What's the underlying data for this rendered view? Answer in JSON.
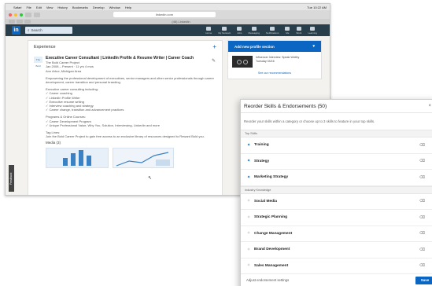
{
  "browser": {
    "menu_items": [
      "Safari",
      "File",
      "Edit",
      "View",
      "History",
      "Bookmarks",
      "Develop",
      "Window",
      "Help"
    ],
    "clock": "Tue 10:22 AM",
    "url": "linkedin.com",
    "tab_title": "(46) LinkedIn"
  },
  "linkedin": {
    "logo": "in",
    "search_placeholder": "Search",
    "nav": [
      "Home",
      "My Network",
      "Jobs",
      "Messaging",
      "Notifications",
      "Me",
      "Work",
      "Learning"
    ],
    "experience": {
      "heading": "Experience",
      "company_logo": "The Bold",
      "title": "Executive Career Consultant | LinkedIn Profile & Resume Writer | Career Coach",
      "company": "The Bold Career Project",
      "dates": "Jan 2008 – Present · 11 yrs 4 mos",
      "location": "Ann Arbor, Michigan Area",
      "summary": "Empowering the professional development of executives, senior managers and other senior professionals through career development, career transition and personal branding.",
      "services_label": "Executive career consulting including:",
      "services": [
        "✓ Career coaching",
        "✓ LinkedIn Profile Writer",
        "✓ Executive resume writing",
        "✓ Interview coaching and strategy",
        "✓ Career change, transition and advancement practices"
      ],
      "programs_label": "Programs & Online Courses:",
      "programs": [
        "✓ Career Development Program",
        "✓ Unique Professional Value, Why You, Solution, Interviewing, LinkedIn and more"
      ],
      "tag_label": "Tag Lines:",
      "tagline": "Join the Bold Career Project to gain free access to an exclusive library of resources designed to Reward Bold you.",
      "media_label": "Media (3)"
    },
    "sidebar": {
      "add_section_label": "Add new profile section",
      "item_title": "Influencer Interview: Speak Wolfey",
      "item_meta": "Tuesday 04/16",
      "recommendations_link": "See our recommendations"
    },
    "feedback_label": "Feedback"
  },
  "modal": {
    "title": "Reorder Skills & Endorsements (50)",
    "description": "Reorder your skills within a category or choose up to 3 skills to feature in your top skills.",
    "top_section_label": "Top Skills",
    "top_skills": [
      {
        "name": "Training",
        "pinned": true
      },
      {
        "name": "Strategy",
        "pinned": true
      },
      {
        "name": "Marketing Strategy",
        "pinned": true
      }
    ],
    "industry_section_label": "Industry Knowledge",
    "industry_skills": [
      {
        "name": "Social Media",
        "pinned": false
      },
      {
        "name": "Strategic Planning",
        "pinned": false
      },
      {
        "name": "Change Management",
        "pinned": false
      },
      {
        "name": "Brand Development",
        "pinned": false
      },
      {
        "name": "Sales Management",
        "pinned": false
      }
    ],
    "footer_link": "Adjust endorsement settings",
    "save_label": "Save",
    "close_glyph": "×",
    "icons": {
      "pin": "pin-icon",
      "trash": "trash-icon",
      "drag": "drag-handle-icon"
    }
  },
  "colors": {
    "linkedin_blue": "#0a66c2",
    "header_navy": "#283e4a"
  }
}
